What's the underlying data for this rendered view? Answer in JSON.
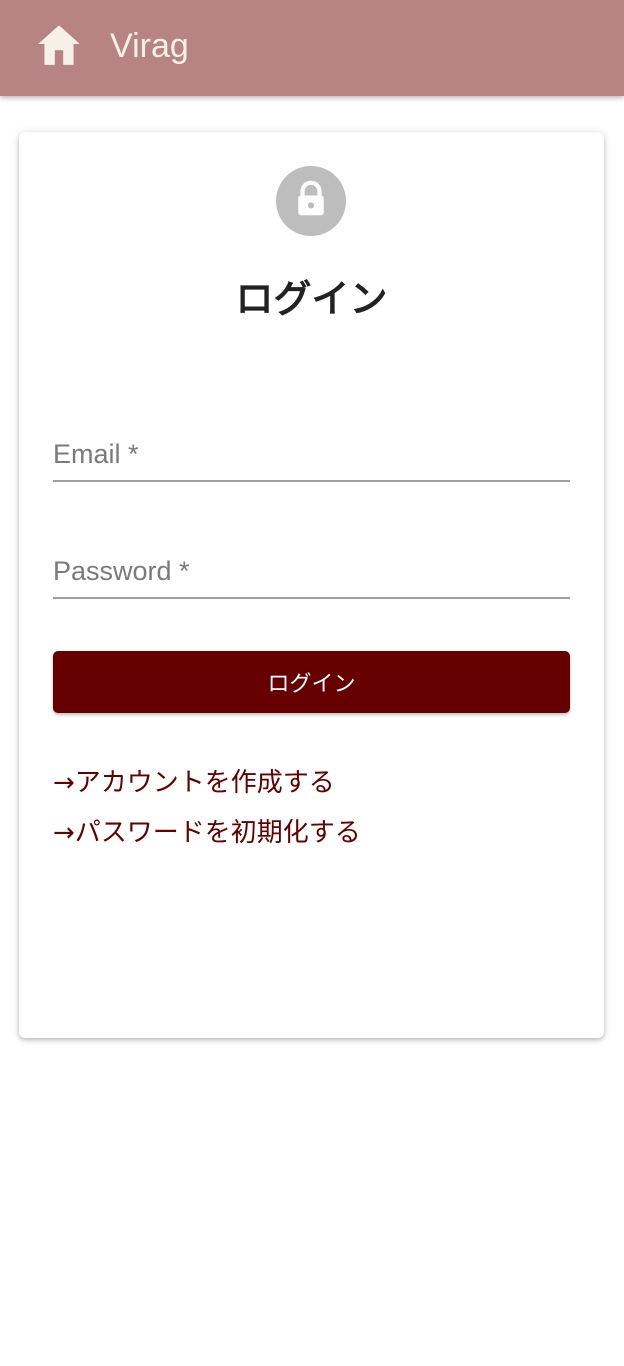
{
  "appbar": {
    "title": "Virag",
    "home_icon": "home-icon",
    "background_color": "#b88383",
    "text_color": "#f5f1e6"
  },
  "login": {
    "avatar_icon": "lock-icon",
    "title": "ログイン",
    "email_label": "Email *",
    "email_value": "",
    "password_label": "Password *",
    "password_value": "",
    "submit_label": "ログイン",
    "accent_color": "#660000"
  },
  "links": {
    "create_account": "→アカウントを作成する",
    "reset_password": "→パスワードを初期化する"
  }
}
